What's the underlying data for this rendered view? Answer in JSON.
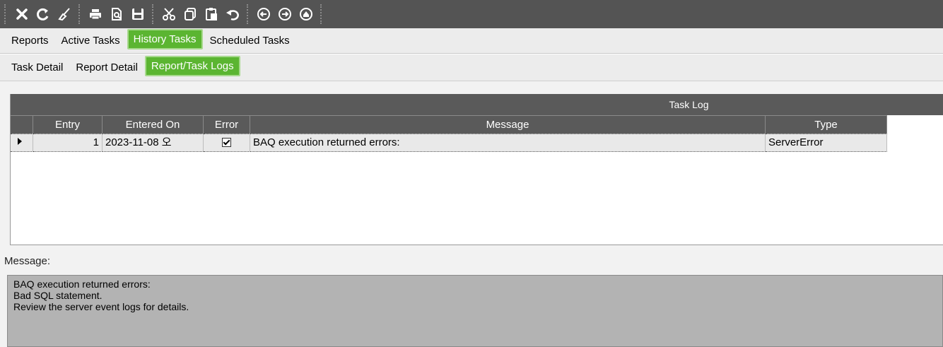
{
  "toolbar": {
    "buttons": [
      {
        "name": "clear-icon"
      },
      {
        "name": "refresh-icon"
      },
      {
        "name": "broom-icon"
      },
      {
        "name": "print-icon"
      },
      {
        "name": "print-preview-icon"
      },
      {
        "name": "save-icon"
      },
      {
        "name": "cut-icon"
      },
      {
        "name": "copy-icon"
      },
      {
        "name": "paste-icon"
      },
      {
        "name": "undo-icon"
      },
      {
        "name": "back-icon"
      },
      {
        "name": "forward-icon"
      },
      {
        "name": "home-icon"
      }
    ]
  },
  "tabs_main": [
    {
      "label": "Reports"
    },
    {
      "label": "Active Tasks"
    },
    {
      "label": "History Tasks",
      "active": true
    },
    {
      "label": "Scheduled Tasks"
    }
  ],
  "tabs_sub": [
    {
      "label": "Task Detail"
    },
    {
      "label": "Report Detail"
    },
    {
      "label": "Report/Task Logs",
      "active": true
    }
  ],
  "grid": {
    "title": "Task Log",
    "columns": [
      "Entry",
      "Entered On",
      "Error",
      "Message",
      "Type"
    ],
    "rows": [
      {
        "entry": "1",
        "entered_on": "2023-11-08 오",
        "error": true,
        "message": "BAQ execution returned errors:",
        "type": "ServerError"
      }
    ]
  },
  "message": {
    "label": "Message:",
    "lines": [
      "BAQ execution returned errors:",
      "Bad SQL statement.",
      "Review the server event logs for details."
    ]
  },
  "colors": {
    "toolbar_bg": "#545454",
    "tab_active": "#5bb531",
    "grid_header": "#5a5a5a",
    "message_bg": "#b3b3b3"
  }
}
